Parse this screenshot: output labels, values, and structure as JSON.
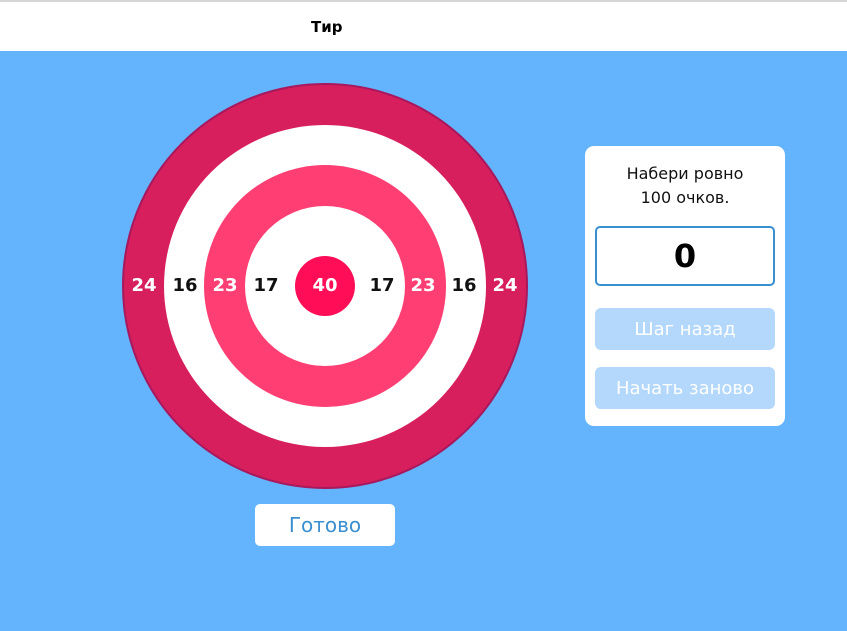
{
  "header": {
    "title": "Тир"
  },
  "target": {
    "labels": [
      "24",
      "16",
      "23",
      "17",
      "40",
      "17",
      "23",
      "16",
      "24"
    ]
  },
  "panel": {
    "instruction_line1": "Набери ровно",
    "instruction_line2": "100 очков.",
    "score": "0",
    "back_label": "Шаг назад",
    "restart_label": "Начать заново"
  },
  "done_label": "Готово",
  "colors": {
    "background": "#63b3fd",
    "outer_ring": "#d71f5e",
    "pink_ring": "#ff3f73",
    "bullseye": "#ff0e57",
    "accent_blue": "#3a8fd0",
    "disabled_button": "#b3d8fb"
  }
}
